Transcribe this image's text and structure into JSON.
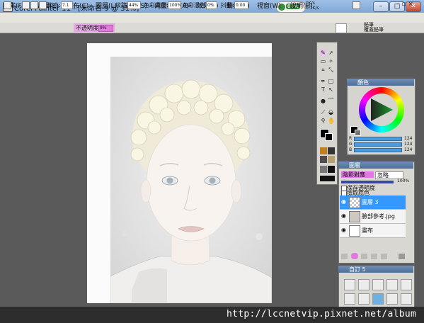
{
  "window": {
    "title": "Corel Painter 11 - [未命名-9 @ 31%]",
    "perf_percent": "61%",
    "speed_up": "0K/s",
    "speed_down": "0.1K/s",
    "controls": {
      "minimize": "–",
      "maximize": "□",
      "close": "✕"
    }
  },
  "menu": {
    "items": [
      "檔案(F)",
      "編輯(E)",
      "畫布(C)",
      "圖層(L)",
      "選取(S)",
      "向量圖形(A)",
      "效果(T)",
      "動畫(M)",
      "視窗(W)",
      "說明(H)"
    ],
    "right_icons": "– ▫ ×"
  },
  "toolbar": {
    "size_label": "大小:",
    "size_value": "7.1",
    "opacity_label": "不透明度:",
    "opacity_value": "9%",
    "grain_label": "紋路:",
    "grain_value": "44%",
    "color_conc_label": "色彩濃度:",
    "color_conc_value": "100%",
    "color_mix_label": "色彩混合:",
    "color_mix_value": "0%",
    "jitter_label": "抖動:",
    "jitter_value": "0.00",
    "brush_category": "鉛筆",
    "brush_variant": "覆蓋鉛筆"
  },
  "colors_panel": {
    "title": "顏色",
    "sliders": [
      {
        "label": "R",
        "value": "124"
      },
      {
        "label": "G",
        "value": "124"
      },
      {
        "label": "B",
        "value": "124"
      }
    ],
    "accent": "#4a9be0"
  },
  "layers_panel": {
    "title": "圖層",
    "composite_method": "陰影對應",
    "blend": "忽略",
    "opacity_value": "100%",
    "preserve_transparency": "保存透明度",
    "pick_up_underlying": "撿取底色",
    "layers": [
      {
        "name": "圖層 3",
        "selected": true
      },
      {
        "name": "臉部參考.jpg",
        "selected": false
      },
      {
        "name": "畫布",
        "selected": false
      }
    ],
    "highlight_color": "#3399ff"
  },
  "custom_panel": {
    "title": "自訂 5"
  },
  "watermark": "http://lccnetvip.pixnet.net/album"
}
